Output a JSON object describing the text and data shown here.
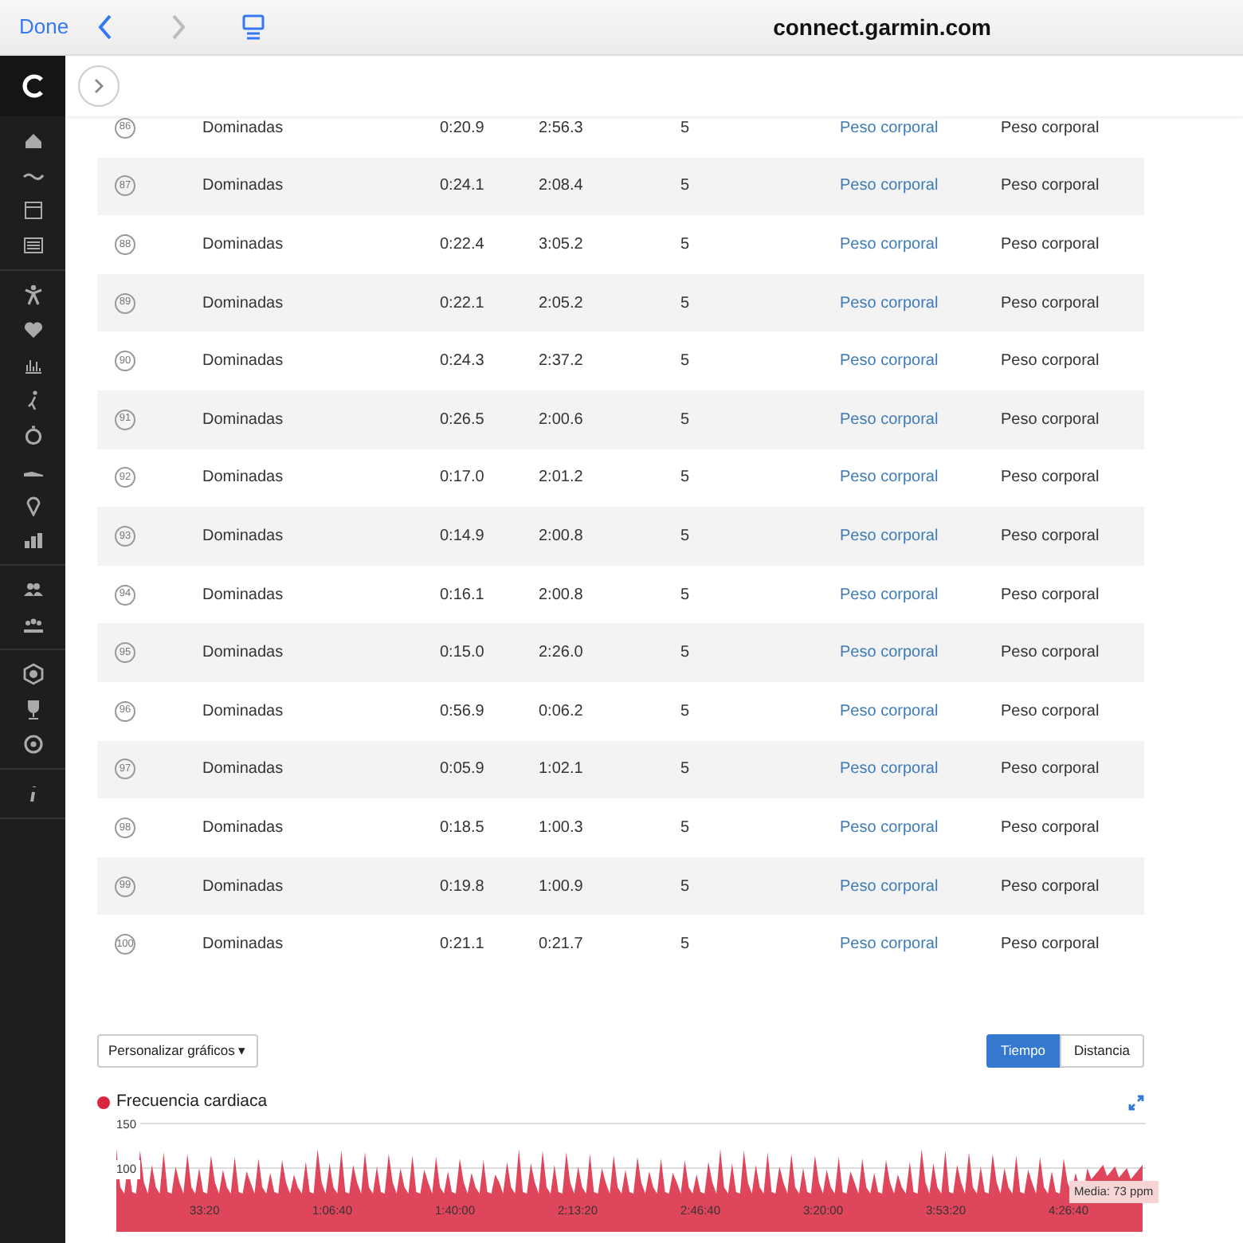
{
  "browser": {
    "done": "Done",
    "back_disabled": false,
    "forward_disabled": true,
    "url": "connect.garmin.com"
  },
  "table": {
    "rows": [
      {
        "set": "86",
        "cells": [
          "Dominadas",
          "0:20.9",
          "2:56.3",
          "5",
          "Peso corporal",
          "Peso corporal"
        ]
      },
      {
        "set": "87",
        "cells": [
          "Dominadas",
          "0:24.1",
          "2:08.4",
          "5",
          "Peso corporal",
          "Peso corporal"
        ]
      },
      {
        "set": "88",
        "cells": [
          "Dominadas",
          "0:22.4",
          "3:05.2",
          "5",
          "Peso corporal",
          "Peso corporal"
        ]
      },
      {
        "set": "89",
        "cells": [
          "Dominadas",
          "0:22.1",
          "2:05.2",
          "5",
          "Peso corporal",
          "Peso corporal"
        ]
      },
      {
        "set": "90",
        "cells": [
          "Dominadas",
          "0:24.3",
          "2:37.2",
          "5",
          "Peso corporal",
          "Peso corporal"
        ]
      },
      {
        "set": "91",
        "cells": [
          "Dominadas",
          "0:26.5",
          "2:00.6",
          "5",
          "Peso corporal",
          "Peso corporal"
        ]
      },
      {
        "set": "92",
        "cells": [
          "Dominadas",
          "0:17.0",
          "2:01.2",
          "5",
          "Peso corporal",
          "Peso corporal"
        ]
      },
      {
        "set": "93",
        "cells": [
          "Dominadas",
          "0:14.9",
          "2:00.8",
          "5",
          "Peso corporal",
          "Peso corporal"
        ]
      },
      {
        "set": "94",
        "cells": [
          "Dominadas",
          "0:16.1",
          "2:00.8",
          "5",
          "Peso corporal",
          "Peso corporal"
        ]
      },
      {
        "set": "95",
        "cells": [
          "Dominadas",
          "0:15.0",
          "2:26.0",
          "5",
          "Peso corporal",
          "Peso corporal"
        ]
      },
      {
        "set": "96",
        "cells": [
          "Dominadas",
          "0:56.9",
          "0:06.2",
          "5",
          "Peso corporal",
          "Peso corporal"
        ]
      },
      {
        "set": "97",
        "cells": [
          "Dominadas",
          "0:05.9",
          "1:02.1",
          "5",
          "Peso corporal",
          "Peso corporal"
        ]
      },
      {
        "set": "98",
        "cells": [
          "Dominadas",
          "0:18.5",
          "1:00.3",
          "5",
          "Peso corporal",
          "Peso corporal"
        ]
      },
      {
        "set": "99",
        "cells": [
          "Dominadas",
          "0:19.8",
          "1:00.9",
          "5",
          "Peso corporal",
          "Peso corporal"
        ]
      },
      {
        "set": "100",
        "cells": [
          "Dominadas",
          "0:21.1",
          "0:21.7",
          "5",
          "Peso corporal",
          "Peso corporal"
        ]
      }
    ]
  },
  "chart_controls": {
    "customize": "Personalizar gráficos ▾",
    "tabs": [
      {
        "label": "Tiempo",
        "selected": true
      },
      {
        "label": "Distancia",
        "selected": false
      }
    ]
  },
  "heart_chart": {
    "title": "Frecuencia cardiaca",
    "color": "#d9263f",
    "y_labels": [
      "150",
      "100"
    ],
    "x_labels": [
      "33:20",
      "1:06:40",
      "1:40:00",
      "2:13:20",
      "2:46:40",
      "3:20:00",
      "3:53:20",
      "4:26:40"
    ],
    "average": "Media: 73 ppm"
  }
}
